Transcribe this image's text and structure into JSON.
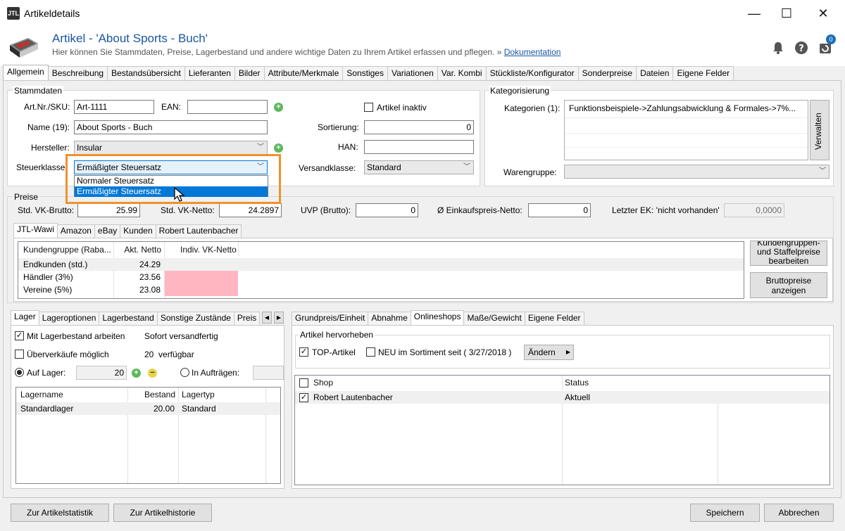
{
  "window": {
    "title": "Artikeldetails",
    "app_icon": "JTL",
    "minimize": "—",
    "maximize": "☐",
    "close": "✕"
  },
  "header": {
    "title": "Artikel - 'About Sports - Buch'",
    "subtitle": "Hier können Sie Stammdaten, Preise, Lagerbestand und andere wichtige Daten zu Ihrem Artikel erfassen und pflegen. » ",
    "doc_link": "Dokumentation",
    "badge_count": "0",
    "icons": [
      "bell-icon",
      "help-icon",
      "refresh-icon"
    ]
  },
  "tabs": [
    "Allgemein",
    "Beschreibung",
    "Bestandsübersicht",
    "Lieferanten",
    "Bilder",
    "Attribute/Merkmale",
    "Sonstiges",
    "Variationen",
    "Var. Kombi",
    "Stückliste/Konfigurator",
    "Sonderpreise",
    "Dateien",
    "Eigene Felder"
  ],
  "stammdaten": {
    "title": "Stammdaten",
    "artnr_label": "Art.Nr./SKU:",
    "artnr_value": "Art-1111",
    "ean_label": "EAN:",
    "ean_value": "",
    "inaktiv_label": "Artikel inaktiv",
    "name_label": "Name (19):",
    "name_value": "About Sports - Buch",
    "sortierung_label": "Sortierung:",
    "sortierung_value": "0",
    "hersteller_label": "Hersteller:",
    "hersteller_value": "Insular",
    "han_label": "HAN:",
    "han_value": "",
    "steuer_label": "Steuerklasse:",
    "steuer_value": "Ermäßigter Steuersatz",
    "steuer_options": [
      "Normaler Steuersatz",
      "Ermäßigter Steuersatz"
    ],
    "versand_label": "Versandklasse:",
    "versand_value": "Standard"
  },
  "kategorisierung": {
    "title": "Kategorisierung",
    "kat_label": "Kategorien (1):",
    "kat_value": "Funktionsbeispiele->Zahlungsabwicklung & Formales->7%...",
    "verwalten": "Verwalten",
    "waren_label": "Warengruppe:",
    "waren_value": ""
  },
  "preise": {
    "title": "Preise",
    "vk_brutto_label": "Std. VK-Brutto:",
    "vk_brutto_value": "25.99",
    "vk_netto_label": "Std. VK-Netto:",
    "vk_netto_value": "24.2897",
    "uvp_label": "UVP (Brutto):",
    "uvp_value": "0",
    "ek_label": "Ø Einkaufspreis-Netto:",
    "ek_value": "0",
    "letzter_label": "Letzter EK: 'nicht vorhanden'",
    "letzter_value": "0,0000",
    "tabs": [
      "JTL-Wawi",
      "Amazon",
      "eBay",
      "Kunden",
      "Robert Lautenbacher"
    ],
    "columns": [
      "Kundengruppe (Raba...",
      "Akt. Netto",
      "Indiv. VK-Netto"
    ],
    "rows": [
      {
        "group": "Endkunden (std.)",
        "netto": "24.29",
        "indiv": ""
      },
      {
        "group": "Händler (3%)",
        "netto": "23.56",
        "indiv": ""
      },
      {
        "group": "Vereine (5%)",
        "netto": "23.08",
        "indiv": ""
      }
    ],
    "btn_kunden": "Kundengruppen- und Staffelpreise bearbeiten",
    "btn_brutto": "Bruttopreise anzeigen"
  },
  "lager": {
    "tabs": [
      "Lager",
      "Lageroptionen",
      "Lagerbestand",
      "Sonstige Zustände",
      "Preis"
    ],
    "mit_lager": "Mit Lagerbestand arbeiten",
    "sofort": "Sofort versandfertig",
    "ueberverkauf": "Überverkäufe möglich",
    "verfuegbar": "20  verfügbar",
    "auf_lager": "Auf Lager:",
    "auf_lager_value": "20",
    "in_auftraegen": "In Aufträgen:",
    "columns": [
      "Lagername",
      "Bestand",
      "Lagertyp"
    ],
    "rows": [
      {
        "name": "Standardlager",
        "bestand": "20.00",
        "typ": "Standard"
      }
    ]
  },
  "online": {
    "tabs": [
      "Grundpreis/Einheit",
      "Abnahme",
      "Onlineshops",
      "Maße/Gewicht",
      "Eigene Felder"
    ],
    "hervor_title": "Artikel hervorheben",
    "top": "TOP-Artikel",
    "neu": "NEU im Sortiment seit ( 3/27/2018 )",
    "aendern": "Ändern",
    "columns": [
      "Shop",
      "Status"
    ],
    "rows": [
      {
        "shop": "Robert Lautenbacher",
        "status": "Aktuell"
      }
    ]
  },
  "footer": {
    "statistik": "Zur Artikelstatistik",
    "historie": "Zur Artikelhistorie",
    "speichern": "Speichern",
    "abbrechen": "Abbrechen"
  },
  "colors": {
    "accent": "#1a56a4",
    "highlight": "#f0922c",
    "selection": "#0078d7",
    "pink": "#ffb6c1"
  }
}
